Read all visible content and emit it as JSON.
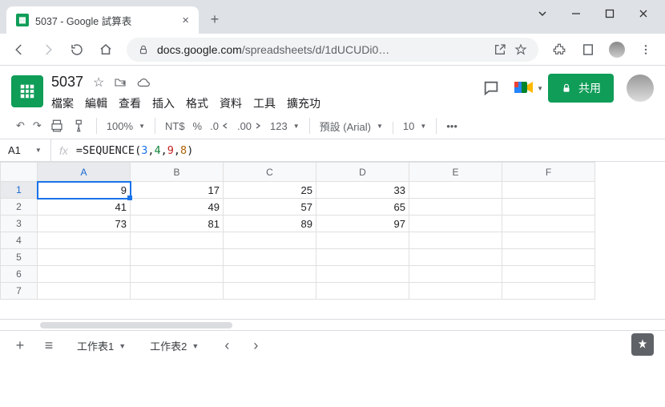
{
  "browser": {
    "tab_title": "5037 - Google 試算表",
    "url_host": "docs.google.com",
    "url_path": "/spreadsheets/d/1dUCUDi0…"
  },
  "header": {
    "doc_title": "5037",
    "menus": [
      "檔案",
      "編輯",
      "查看",
      "插入",
      "格式",
      "資料",
      "工具",
      "擴充功"
    ],
    "share_label": "共用"
  },
  "toolbar": {
    "zoom": "100%",
    "currency": "NT$",
    "percent": "%",
    "dec_dec": ".0",
    "inc_dec": ".00",
    "more_fmt": "123",
    "font": "預設 (Arial)",
    "font_size": "10"
  },
  "formula_bar": {
    "name_box": "A1",
    "fn": "SEQUENCE",
    "args": [
      "3",
      "4",
      "9",
      "8"
    ]
  },
  "grid": {
    "columns": [
      "A",
      "B",
      "C",
      "D",
      "E",
      "F"
    ],
    "rows": [
      "1",
      "2",
      "3",
      "4",
      "5",
      "6",
      "7"
    ],
    "selected_cell": "A1",
    "data": [
      [
        "9",
        "17",
        "25",
        "33",
        "",
        ""
      ],
      [
        "41",
        "49",
        "57",
        "65",
        "",
        ""
      ],
      [
        "73",
        "81",
        "89",
        "97",
        "",
        ""
      ],
      [
        "",
        "",
        "",
        "",
        "",
        ""
      ],
      [
        "",
        "",
        "",
        "",
        "",
        ""
      ],
      [
        "",
        "",
        "",
        "",
        "",
        ""
      ],
      [
        "",
        "",
        "",
        "",
        "",
        ""
      ]
    ]
  },
  "sheets": {
    "tabs": [
      {
        "label": "工作表1",
        "active": true
      },
      {
        "label": "工作表2",
        "active": false
      }
    ]
  },
  "icons": {
    "undo": "↶",
    "redo": "↷"
  }
}
